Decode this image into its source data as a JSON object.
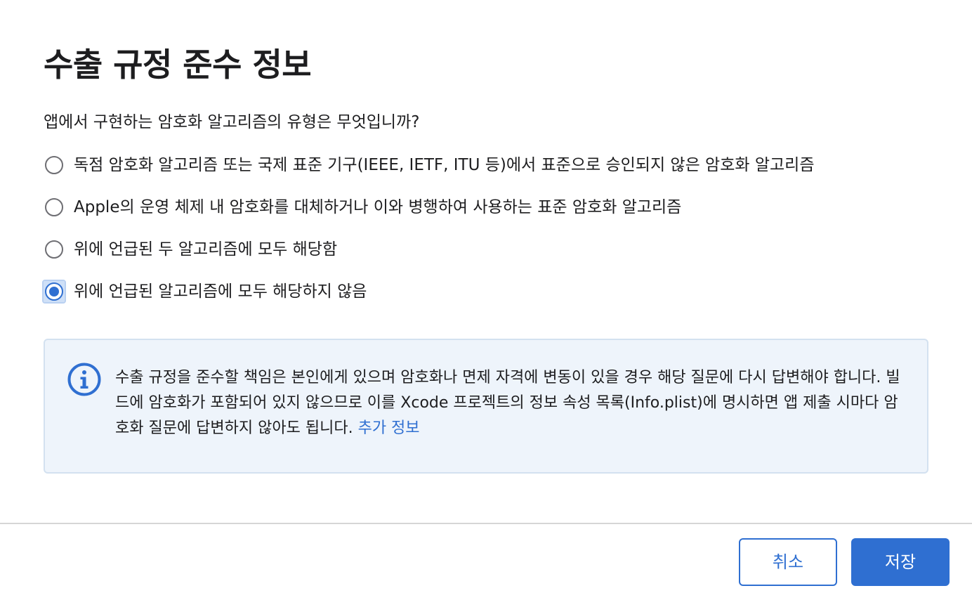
{
  "dialog": {
    "title": "수출 규정 준수 정보",
    "question": "앱에서 구현하는 암호화 알고리즘의 유형은 무엇입니까?",
    "options": [
      {
        "label": "독점 암호화 알고리즘 또는 국제 표준 기구(IEEE, IETF, ITU 등)에서 표준으로 승인되지 않은 암호화 알고리즘",
        "checked": false
      },
      {
        "label": "Apple의 운영 체제 내 암호화를 대체하거나 이와 병행하여 사용하는 표준 암호화 알고리즘",
        "checked": false
      },
      {
        "label": "위에 언급된 두 알고리즘에 모두 해당함",
        "checked": false
      },
      {
        "label": "위에 언급된 알고리즘에 모두 해당하지 않음",
        "checked": true
      }
    ],
    "info": {
      "icon": "info-icon",
      "text": "수출 규정을 준수할 책임은 본인에게 있으며 암호화나 면제 자격에 변동이 있을 경우 해당 질문에 다시 답변해야 합니다. 빌드에 암호화가 포함되어 있지 않으므로 이를 Xcode 프로젝트의 정보 속성 목록(Info.plist)에 명시하면 앱 제출 시마다 암호화 질문에 답변하지 않아도 됩니다.",
      "link": "추가 정보"
    },
    "buttons": {
      "cancel": "취소",
      "save": "저장"
    },
    "colors": {
      "accent": "#2f6fd1",
      "info_bg": "#eef4fb"
    }
  }
}
